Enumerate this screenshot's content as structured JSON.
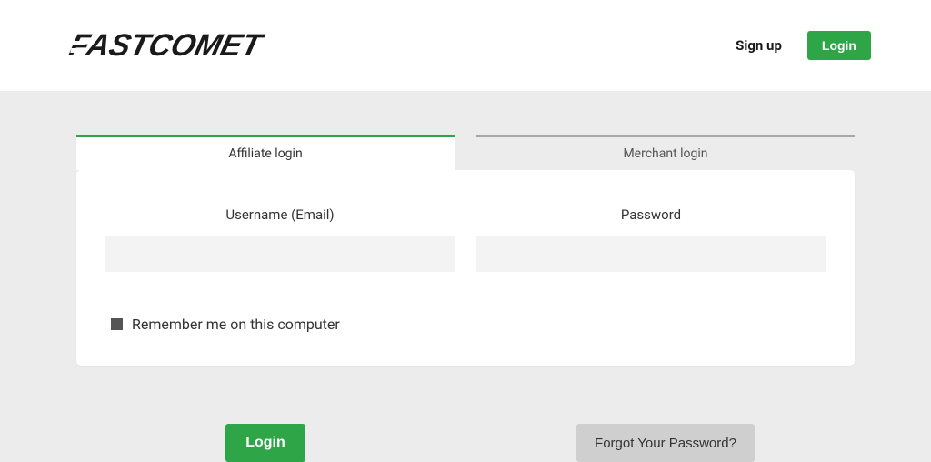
{
  "header": {
    "brand": "FASTCOMET",
    "signup": "Sign up",
    "login_btn": "Login"
  },
  "tabs": {
    "affiliate": "Affiliate login",
    "merchant": "Merchant login"
  },
  "form": {
    "username_label": "Username (Email)",
    "password_label": "Password",
    "username_value": "",
    "password_value": "",
    "remember_label": "Remember me on this computer"
  },
  "actions": {
    "login": "Login",
    "forgot": "Forgot Your Password?"
  }
}
